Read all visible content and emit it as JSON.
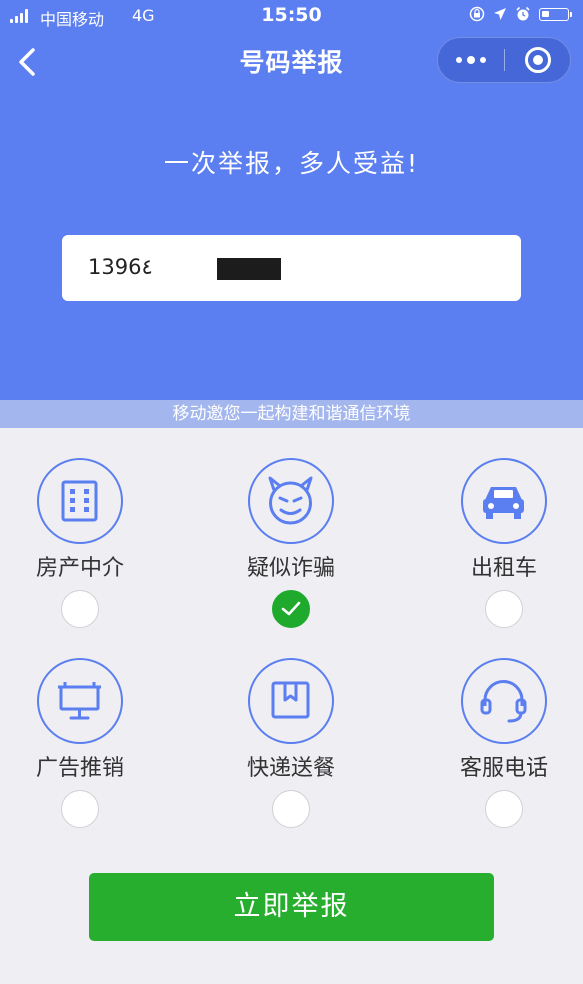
{
  "status_bar": {
    "carrier": "中国移动",
    "network": "4G",
    "time": "15:50"
  },
  "nav": {
    "title": "号码举报"
  },
  "slogan": "一次举报，多人受益!",
  "phone_input": {
    "value": "1396٤"
  },
  "banner": "移动邀您一起构建和谐通信环境",
  "categories": [
    {
      "label": "房产中介",
      "icon": "building-icon",
      "selected": false
    },
    {
      "label": "疑似诈骗",
      "icon": "devil-face-icon",
      "selected": true
    },
    {
      "label": "出租车",
      "icon": "car-icon",
      "selected": false
    },
    {
      "label": "广告推销",
      "icon": "billboard-icon",
      "selected": false
    },
    {
      "label": "快递送餐",
      "icon": "package-icon",
      "selected": false
    },
    {
      "label": "客服电话",
      "icon": "headset-icon",
      "selected": false
    }
  ],
  "submit_label": "立即举报",
  "colors": {
    "header_bg": "#5b7ef0",
    "banner_bg": "#a4b6ee",
    "page_bg": "#eeeef3",
    "accent_green": "#27ae2e",
    "icon_blue": "#5b7ef0"
  }
}
